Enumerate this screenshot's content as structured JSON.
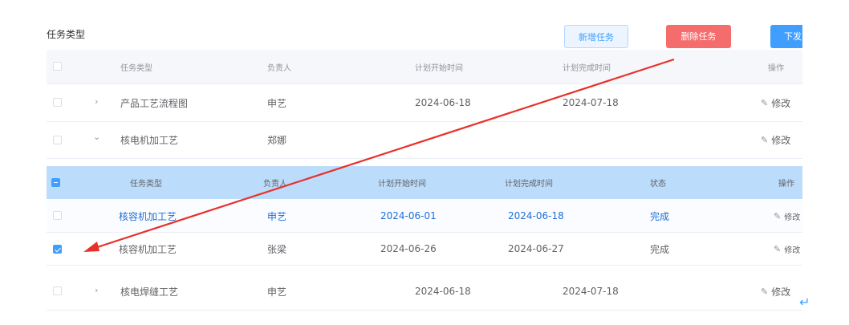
{
  "section_title": "任务类型",
  "buttons": {
    "add": "新增任务",
    "delete": "删除任务",
    "issue": "下发"
  },
  "outer_headers": [
    "任务类型",
    "负责人",
    "计划开始时间",
    "计划完成时间",
    "操作"
  ],
  "outer_rows": [
    {
      "type": "产品工艺流程图",
      "owner": "申艺",
      "start": "2024-06-18",
      "end": "2024-07-18",
      "action": "修改",
      "expand": "›"
    },
    {
      "type": "核电机加工艺",
      "owner": "郑娜",
      "start": "",
      "end": "",
      "action": "修改",
      "expand": "⌄"
    }
  ],
  "inner_headers": [
    "任务类型",
    "负责人",
    "计划开始时间",
    "计划完成时间",
    "状态",
    "操作"
  ],
  "inner_rows": [
    {
      "type": "核容机加工艺",
      "owner": "申艺",
      "start": "2024-06-01",
      "end": "2024-06-18",
      "status": "完成",
      "action": "修改",
      "checked": false
    },
    {
      "type": "核容机加工艺",
      "owner": "张梁",
      "start": "2024-06-26",
      "end": "2024-06-27",
      "status": "完成",
      "action": "修改",
      "checked": true
    }
  ],
  "last_row": {
    "type": "核电焊缝工艺",
    "owner": "申艺",
    "start": "2024-06-18",
    "end": "2024-07-18",
    "action": "修改",
    "expand": "›"
  },
  "icons": {
    "edit": "edit-icon",
    "return": "return-icon",
    "arrow": "annotation-arrow"
  },
  "colors": {
    "primary": "#409eff",
    "danger": "#f56c6c",
    "arrow": "#e8312a",
    "selected_header": "#bcdcfb"
  }
}
